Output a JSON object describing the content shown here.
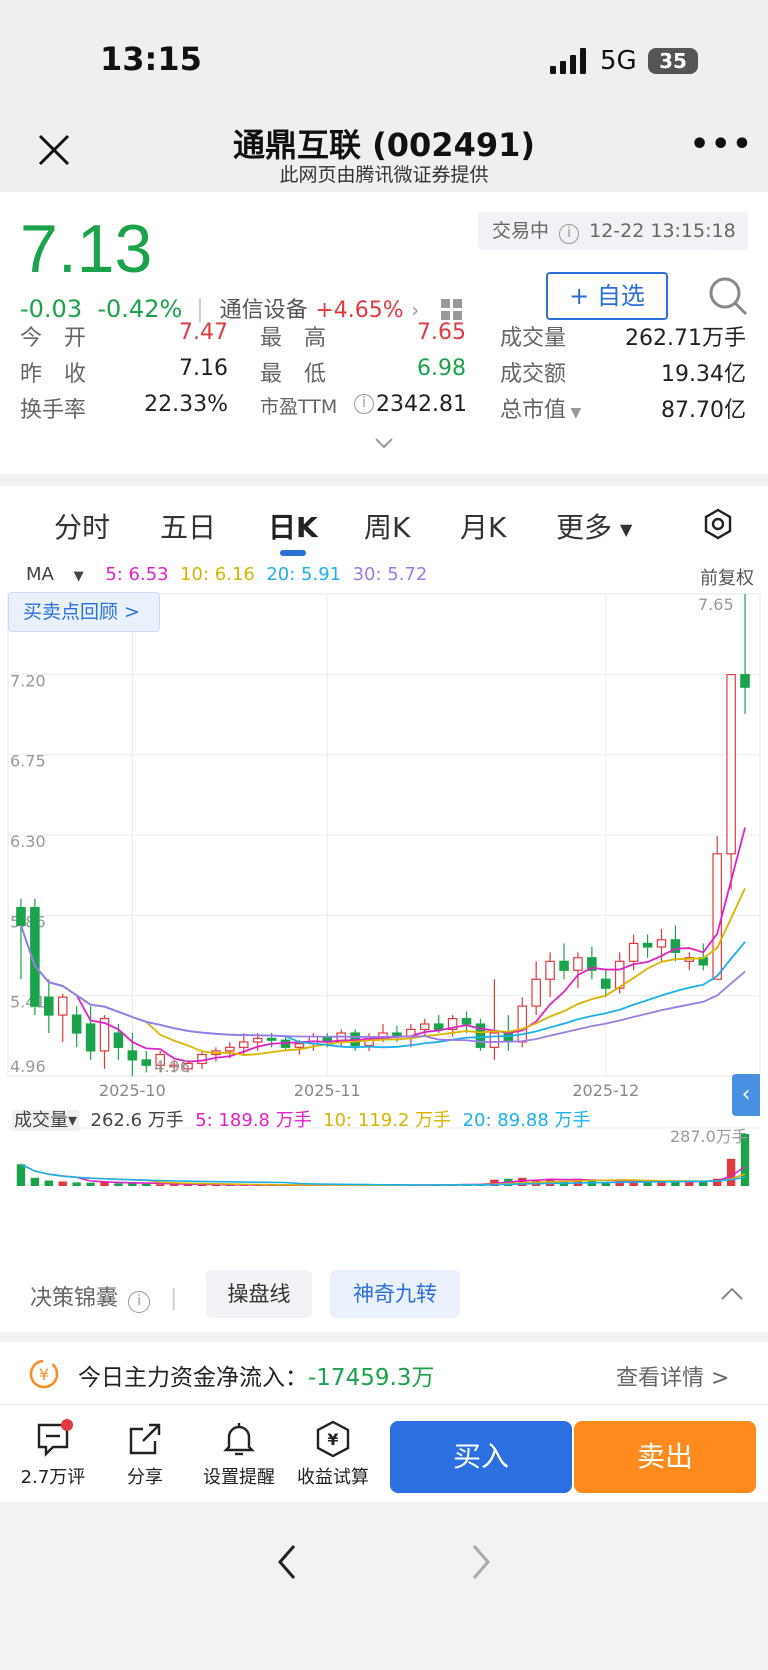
{
  "status_bar": {
    "time": "13:15",
    "network": "5G",
    "battery": "35"
  },
  "header": {
    "title": "通鼎互联 (002491)",
    "subtitle": "此网页由腾讯微证券提供"
  },
  "quote": {
    "price": "7.13",
    "change": "-0.03",
    "change_pct": "-0.42%",
    "industry": "通信设备",
    "industry_change": "+4.65%",
    "trade_status": "交易中",
    "timestamp": "12-22 13:15:18",
    "watch_label": "+ 自选",
    "stats": {
      "open_label": "今　开",
      "open": "7.47",
      "high_label": "最　高",
      "high": "7.65",
      "volume_label": "成交量",
      "volume": "262.71万手",
      "prev_close_label": "昨　收",
      "prev_close": "7.16",
      "low_label": "最　低",
      "low": "6.98",
      "amount_label": "成交额",
      "amount": "19.34亿",
      "turnover_label": "换手率",
      "turnover": "22.33%",
      "pe_label": "市盈TTM",
      "pe": "2342.81",
      "mktcap_label": "总市值",
      "mktcap": "87.70亿"
    }
  },
  "tabs": {
    "items": [
      "分时",
      "五日",
      "日K",
      "周K",
      "月K",
      "更多"
    ],
    "active": "日K"
  },
  "chart_header": {
    "ma_selector": "MA",
    "ma5": "5: 6.53",
    "ma10": "10: 6.16",
    "ma20": "20: 5.91",
    "ma30": "30: 5.72",
    "adjust": "前复权",
    "review_button": "买卖点回顾 >"
  },
  "volume_legend": {
    "label": "成交量▾",
    "total": "262.6 万手",
    "ma5": "5: 189.8 万手",
    "ma10": "10: 119.2 万手",
    "ma20": "20: 89.88 万手",
    "max_label": "287.0万手"
  },
  "tools": {
    "title": "决策锦囊",
    "chip1": "操盘线",
    "chip2": "神奇九转"
  },
  "flow": {
    "label": "今日主力资金净流入：",
    "value": "-17459.3万",
    "detail": "查看详情 >"
  },
  "bottom_bar": {
    "comments": "2.7万评",
    "share": "分享",
    "alert": "设置提醒",
    "calc": "收益试算",
    "buy": "买入",
    "sell": "卖出"
  },
  "colors": {
    "up": "#e0393e",
    "down": "#1aa34a",
    "accent": "#2b6fd8",
    "ma5": "#e020c8",
    "ma10": "#d9b400",
    "ma20": "#1ab0ee",
    "ma30": "#9a7de8"
  },
  "chart_data": {
    "type": "candlestick",
    "y_ticks": [
      "7.20",
      "6.75",
      "6.30",
      "5.86",
      "5.41",
      "4.96"
    ],
    "ylim": [
      4.96,
      7.65
    ],
    "x_ticks": [
      "2025-10",
      "2025-11",
      "2025-12"
    ],
    "high_marker": "7.65",
    "low_marker": "4.96",
    "ohlc": [
      [
        5.9,
        5.95,
        5.5,
        5.8
      ],
      [
        5.9,
        5.95,
        5.3,
        5.35
      ],
      [
        5.4,
        5.5,
        5.2,
        5.3
      ],
      [
        5.3,
        5.42,
        5.15,
        5.4
      ],
      [
        5.3,
        5.35,
        5.12,
        5.2
      ],
      [
        5.25,
        5.35,
        5.05,
        5.1
      ],
      [
        5.1,
        5.3,
        5.0,
        5.28
      ],
      [
        5.2,
        5.25,
        5.05,
        5.12
      ],
      [
        5.1,
        5.2,
        4.96,
        5.05
      ],
      [
        5.05,
        5.1,
        4.98,
        5.02
      ],
      [
        5.02,
        5.1,
        4.98,
        5.08
      ],
      [
        5.02,
        5.05,
        4.98,
        5.02
      ],
      [
        5.0,
        5.05,
        4.98,
        5.03
      ],
      [
        5.03,
        5.1,
        5.0,
        5.08
      ],
      [
        5.08,
        5.12,
        5.04,
        5.1
      ],
      [
        5.1,
        5.15,
        5.06,
        5.12
      ],
      [
        5.12,
        5.2,
        5.08,
        5.15
      ],
      [
        5.15,
        5.2,
        5.1,
        5.17
      ],
      [
        5.17,
        5.2,
        5.12,
        5.16
      ],
      [
        5.16,
        5.18,
        5.1,
        5.12
      ],
      [
        5.12,
        5.16,
        5.08,
        5.14
      ],
      [
        5.14,
        5.2,
        5.1,
        5.18
      ],
      [
        5.18,
        5.2,
        5.12,
        5.15
      ],
      [
        5.15,
        5.22,
        5.12,
        5.2
      ],
      [
        5.2,
        5.22,
        5.1,
        5.13
      ],
      [
        5.13,
        5.2,
        5.1,
        5.18
      ],
      [
        5.18,
        5.25,
        5.15,
        5.2
      ],
      [
        5.2,
        5.24,
        5.15,
        5.18
      ],
      [
        5.18,
        5.25,
        5.12,
        5.22
      ],
      [
        5.22,
        5.28,
        5.18,
        5.25
      ],
      [
        5.25,
        5.3,
        5.2,
        5.22
      ],
      [
        5.22,
        5.3,
        5.18,
        5.28
      ],
      [
        5.28,
        5.32,
        5.2,
        5.25
      ],
      [
        5.25,
        5.28,
        5.1,
        5.12
      ],
      [
        5.12,
        5.5,
        5.05,
        5.2
      ],
      [
        5.2,
        5.3,
        5.1,
        5.15
      ],
      [
        5.15,
        5.4,
        5.12,
        5.35
      ],
      [
        5.35,
        5.6,
        5.3,
        5.5
      ],
      [
        5.5,
        5.65,
        5.4,
        5.6
      ],
      [
        5.6,
        5.7,
        5.5,
        5.55
      ],
      [
        5.55,
        5.65,
        5.45,
        5.62
      ],
      [
        5.62,
        5.68,
        5.5,
        5.55
      ],
      [
        5.5,
        5.55,
        5.4,
        5.45
      ],
      [
        5.45,
        5.65,
        5.42,
        5.6
      ],
      [
        5.6,
        5.75,
        5.55,
        5.7
      ],
      [
        5.7,
        5.75,
        5.62,
        5.68
      ],
      [
        5.68,
        5.78,
        5.6,
        5.72
      ],
      [
        5.72,
        5.8,
        5.6,
        5.65
      ],
      [
        5.6,
        5.65,
        5.55,
        5.62
      ],
      [
        5.62,
        5.7,
        5.55,
        5.58
      ],
      [
        5.5,
        6.3,
        5.5,
        6.2
      ],
      [
        6.2,
        7.2,
        6.0,
        7.2
      ],
      [
        7.2,
        7.65,
        6.98,
        7.13
      ]
    ],
    "volume": [
      120,
      45,
      30,
      25,
      20,
      18,
      22,
      15,
      14,
      12,
      10,
      8,
      8,
      7,
      6,
      6,
      5,
      5,
      5,
      4,
      4,
      5,
      4,
      5,
      4,
      6,
      5,
      5,
      6,
      8,
      7,
      8,
      10,
      12,
      35,
      40,
      45,
      30,
      35,
      28,
      40,
      30,
      22,
      30,
      26,
      20,
      22,
      24,
      30,
      28,
      40,
      150,
      287
    ]
  }
}
